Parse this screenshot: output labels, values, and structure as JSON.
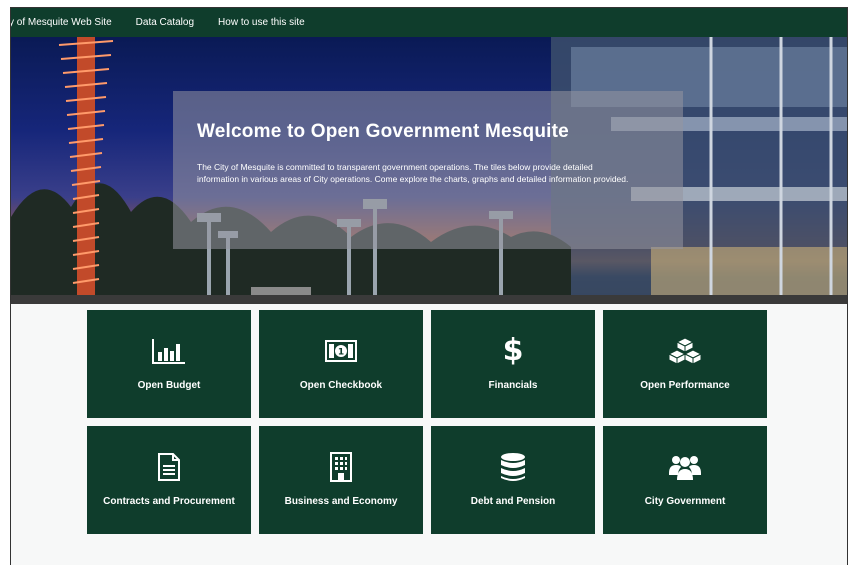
{
  "nav": {
    "items": [
      {
        "label": "y of Mesquite Web Site"
      },
      {
        "label": "Data Catalog"
      },
      {
        "label": "How to use this site"
      }
    ]
  },
  "hero": {
    "title": "Welcome to Open Government Mesquite",
    "description": "The City of Mesquite is committed to transparent government operations. The tiles below provide detailed information in various areas of City operations. Come explore the charts, graphs and detailed information provided."
  },
  "tiles": [
    {
      "label": "Open Budget",
      "icon": "bar-chart-icon"
    },
    {
      "label": "Open Checkbook",
      "icon": "money-icon"
    },
    {
      "label": "Financials",
      "icon": "dollar-icon"
    },
    {
      "label": "Open Performance",
      "icon": "cubes-icon"
    },
    {
      "label": "Contracts and Procurement",
      "icon": "document-icon"
    },
    {
      "label": "Business and Economy",
      "icon": "building-icon"
    },
    {
      "label": "Debt and Pension",
      "icon": "database-icon"
    },
    {
      "label": "City Government",
      "icon": "users-icon"
    }
  ],
  "colors": {
    "nav": "#0f3d2c",
    "tile": "#0f3d2c"
  }
}
